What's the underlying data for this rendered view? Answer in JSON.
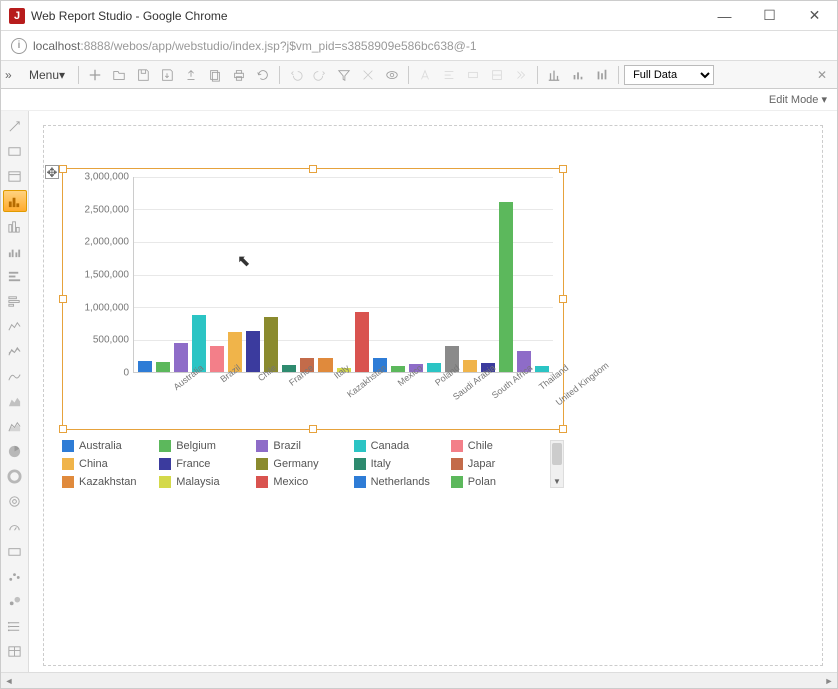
{
  "window": {
    "title": "Web Report Studio - Google Chrome",
    "favicon_letter": "J"
  },
  "url": {
    "host": "localhost",
    "port": ":8888",
    "path": "/webos/app/webstudio/index.jsp?j$vm_pid=s3858909e586bc638@-1"
  },
  "toolbar": {
    "menu_label": "Menu",
    "data_dropdown": "Full Data",
    "edit_mode": "Edit Mode"
  },
  "chart_data": {
    "type": "bar",
    "ylim": [
      0,
      3000000
    ],
    "yticks": [
      0,
      500000,
      1000000,
      1500000,
      2000000,
      2500000,
      3000000
    ],
    "ytick_labels": [
      "0",
      "500,000",
      "1,000,000",
      "1,500,000",
      "2,000,000",
      "2,500,000",
      "3,000,000"
    ],
    "series": [
      {
        "name": "Australia",
        "value": 170000,
        "color": "#2e7cd6"
      },
      {
        "name": "Belgium",
        "value": 160000,
        "color": "#5cb85c"
      },
      {
        "name": "Brazil",
        "value": 450000,
        "color": "#8e6cc8"
      },
      {
        "name": "Canada",
        "value": 880000,
        "color": "#2bc4c4"
      },
      {
        "name": "Chile",
        "value": 400000,
        "color": "#f37f89"
      },
      {
        "name": "China",
        "value": 620000,
        "color": "#f0b44a"
      },
      {
        "name": "France",
        "value": 630000,
        "color": "#3b3b9e"
      },
      {
        "name": "Germany",
        "value": 850000,
        "color": "#8a8a2e"
      },
      {
        "name": "Italy",
        "value": 110000,
        "color": "#2e8b6f"
      },
      {
        "name": "Japan",
        "value": 210000,
        "color": "#c36b4a"
      },
      {
        "name": "Kazakhstan",
        "value": 210000,
        "color": "#e08a3c"
      },
      {
        "name": "Malaysia",
        "value": 60000,
        "color": "#d4d94a"
      },
      {
        "name": "Mexico",
        "value": 920000,
        "color": "#d9534f"
      },
      {
        "name": "Netherlands",
        "value": 210000,
        "color": "#2e7cd6"
      },
      {
        "name": "Poland",
        "value": 100000,
        "color": "#5cb85c"
      },
      {
        "name": "Saudi Arabia",
        "value": 120000,
        "color": "#8e6cc8"
      },
      {
        "name": "South Africa",
        "value": 140000,
        "color": "#2bc4c4"
      },
      {
        "name": "Thailand",
        "value": 400000,
        "color": "#8a8a8a"
      },
      {
        "name": "United Kingdom",
        "value": 180000,
        "color": "#f0b44a"
      },
      {
        "name": "",
        "value": 140000,
        "color": "#3b3b9e"
      },
      {
        "name": "",
        "value": 2620000,
        "color": "#5cb85c"
      },
      {
        "name": "",
        "value": 320000,
        "color": "#8e6cc8"
      },
      {
        "name": "",
        "value": 90000,
        "color": "#2bc4c4"
      }
    ],
    "x_labels": [
      "Australia",
      "Brazil",
      "Chile",
      "France",
      "Italy",
      "Kazakhstan",
      "Mexico",
      "Poland",
      "Saudi Arabia",
      "South Africa",
      "Thailand",
      "United Kingdom"
    ]
  },
  "legend": [
    {
      "label": "Australia",
      "color": "#2e7cd6"
    },
    {
      "label": "Belgium",
      "color": "#5cb85c"
    },
    {
      "label": "Brazil",
      "color": "#8e6cc8"
    },
    {
      "label": "Canada",
      "color": "#2bc4c4"
    },
    {
      "label": "Chile",
      "color": "#f37f89"
    },
    {
      "label": "China",
      "color": "#f0b44a"
    },
    {
      "label": "France",
      "color": "#3b3b9e"
    },
    {
      "label": "Germany",
      "color": "#8a8a2e"
    },
    {
      "label": "Italy",
      "color": "#2e8b6f"
    },
    {
      "label": "Japar",
      "color": "#c36b4a"
    },
    {
      "label": "Kazakhstan",
      "color": "#e08a3c"
    },
    {
      "label": "Malaysia",
      "color": "#d4d94a"
    },
    {
      "label": "Mexico",
      "color": "#d9534f"
    },
    {
      "label": "Netherlands",
      "color": "#2e7cd6"
    },
    {
      "label": "Polan",
      "color": "#5cb85c"
    }
  ]
}
